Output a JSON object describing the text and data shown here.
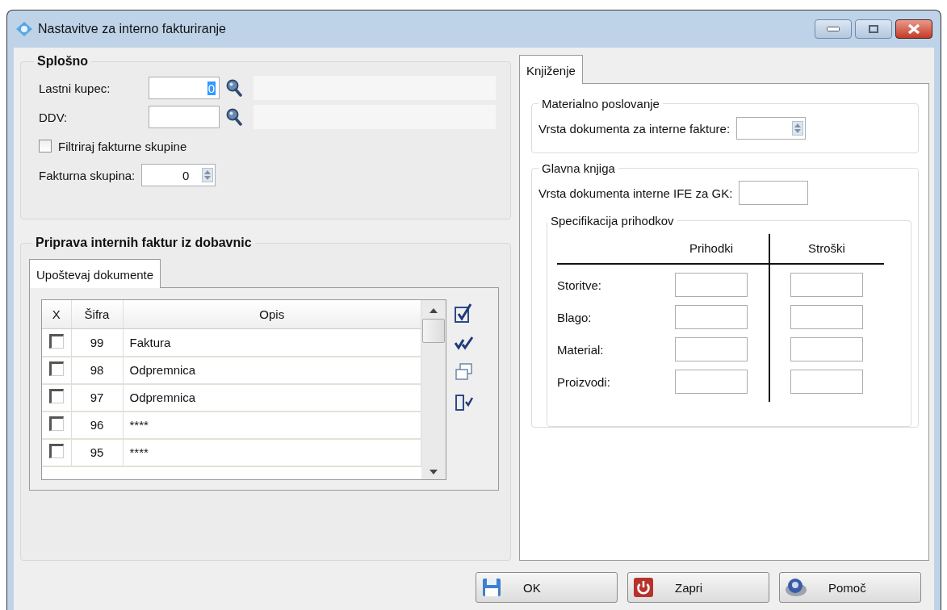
{
  "window": {
    "title": "Nastavitve za interno fakturiranje"
  },
  "general": {
    "title": "Splošno",
    "customer": {
      "label": "Lastni kupec:",
      "value": "0"
    },
    "vat": {
      "label": "DDV:"
    },
    "filter": {
      "label": "Filtriraj fakturne skupine",
      "checked": false
    },
    "group": {
      "label": "Fakturna skupina:",
      "value": "0"
    }
  },
  "prep": {
    "title": "Priprava internih faktur iz dobavnic",
    "tabs": [
      {
        "label": "Upoštevaj dokumente",
        "selected": true
      }
    ],
    "columns": [
      "X",
      "Šifra",
      "Opis"
    ],
    "rows": [
      {
        "checked": false,
        "code": "99",
        "desc": "Faktura"
      },
      {
        "checked": false,
        "code": "98",
        "desc": "Odpremnica"
      },
      {
        "checked": false,
        "code": "97",
        "desc": "Odpremnica"
      },
      {
        "checked": false,
        "code": "96",
        "desc": "****"
      },
      {
        "checked": false,
        "code": "95",
        "desc": "****"
      }
    ]
  },
  "booking": {
    "tabs": [
      {
        "label": "Knjiženje",
        "selected": true
      }
    ],
    "material": {
      "title": "Materialno poslovanje",
      "label": "Vrsta dokumenta za interne fakture:"
    },
    "ledger": {
      "title": "Glavna knjiga",
      "label": "Vrsta dokumenta interne IFE za GK:",
      "spec": {
        "title": "Specifikacija prihodkov",
        "columns": [
          "Prihodki",
          "Stroški"
        ],
        "rows": [
          "Storitve:",
          "Blago:",
          "Material:",
          "Proizvodi:"
        ]
      }
    }
  },
  "buttons": [
    {
      "kind": "save",
      "label": "OK"
    },
    {
      "kind": "close",
      "label": "Zapri"
    },
    {
      "kind": "help",
      "label": "Pomoč"
    }
  ]
}
